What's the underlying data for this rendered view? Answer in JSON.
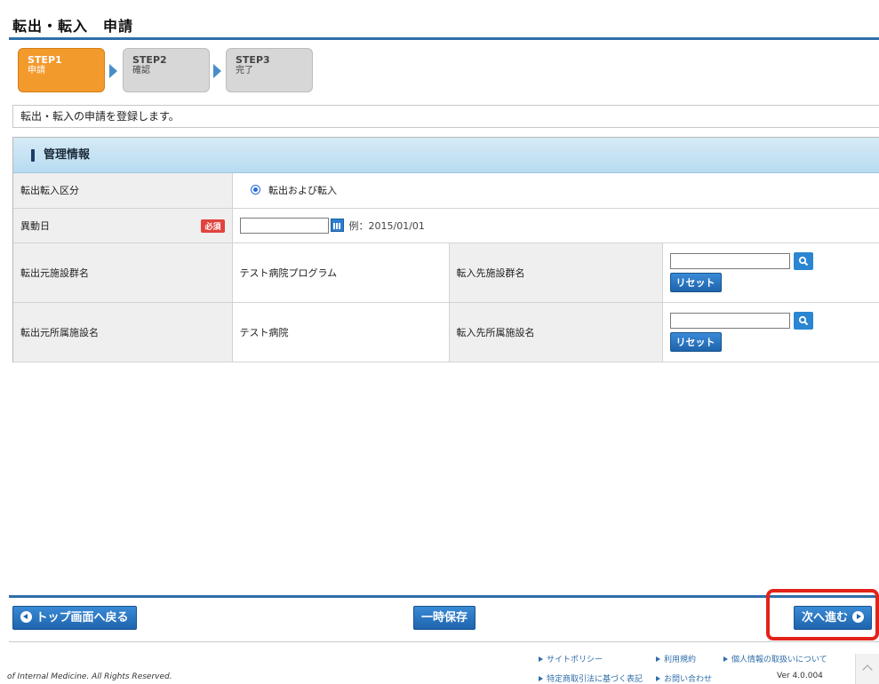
{
  "page": {
    "title": "転出・転入　申請"
  },
  "steps": [
    {
      "no": "STEP1",
      "name": "申請",
      "state": "active"
    },
    {
      "no": "STEP2",
      "name": "確認",
      "state": "inactive"
    },
    {
      "no": "STEP3",
      "name": "完了",
      "state": "inactive"
    }
  ],
  "info_message": "転出・転入の申請を登録します。",
  "section": {
    "title": "管理情報",
    "rows": {
      "transfer_type": {
        "label": "転出転入区分",
        "option": "転出および転入"
      },
      "move_date": {
        "label": "異動日",
        "required": "必須",
        "example": "例：2015/01/01"
      },
      "group": {
        "from_label": "転出元施設群名",
        "from_value": "テスト病院プログラム",
        "to_label": "転入先施設群名",
        "reset": "リセット"
      },
      "facility": {
        "from_label": "転出元所属施設名",
        "from_value": "テスト病院",
        "to_label": "転入先所属施設名",
        "reset": "リセット"
      }
    }
  },
  "actions": {
    "back": "トップ画面へ戻る",
    "save": "一時保存",
    "next": "次へ進む"
  },
  "footer": {
    "copyright": "of Internal Medicine. All Rights Reserved.",
    "links": [
      "サイトポリシー",
      "利用規約",
      "個人情報の取扱いについて",
      "特定商取引法に基づく表記",
      "お問い合わせ"
    ],
    "version": "Ver 4.0.004"
  },
  "colors": {
    "accent": "#2f6eaa",
    "step_active": "#f39a2d",
    "highlight": "#e2231a",
    "required": "#e0433d"
  }
}
